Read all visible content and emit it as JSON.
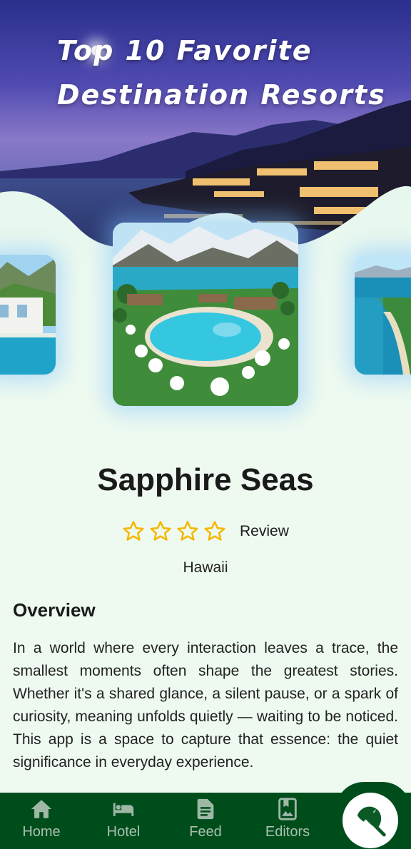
{
  "hero": {
    "title_line1": "Top 10 Favorite",
    "title_line2": "Destination Resorts"
  },
  "carousel": {
    "items": [
      {
        "name": "left-resort-image",
        "icon": "villa-pool-photo"
      },
      {
        "name": "center-resort-image",
        "icon": "lake-pool-resort-photo"
      },
      {
        "name": "right-resort-image",
        "icon": "beach-coast-photo"
      }
    ]
  },
  "resort": {
    "name": "Sapphire Seas",
    "rating_stars": 4,
    "rating_filled": 0,
    "review_label": "Review",
    "location": "Hawaii"
  },
  "overview": {
    "heading": "Overview",
    "text": "In a world where every interaction leaves a trace, the smallest moments often shape the greatest stories. Whether it's a shared glance, a silent pause, or a spark of curiosity, meaning unfolds quietly — waiting to be noticed. This app is a space to capture that essence: the quiet significance in everyday experience."
  },
  "nav": {
    "home": "Home",
    "hotel": "Hotel",
    "feed": "Feed",
    "editors": "Editors",
    "fab_icon": "beach-umbrella-icon"
  },
  "colors": {
    "nav_bg": "#004d1c",
    "page_bg": "#eefaf0",
    "star": "#f5b800"
  }
}
